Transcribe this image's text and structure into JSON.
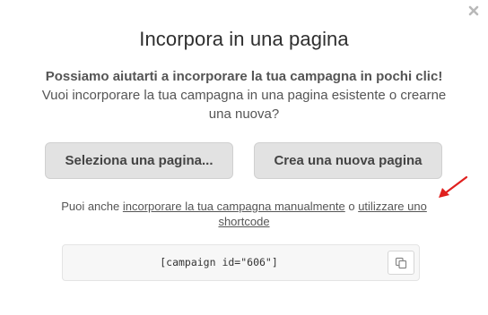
{
  "modal": {
    "close_icon": "close-icon",
    "title": "Incorpora in una pagina",
    "intro_bold": "Possiamo aiutarti a incorporare la tua campagna in pochi clic!",
    "intro_text": "Vuoi incorporare la tua campagna in una pagina esistente o crearne una nuova?"
  },
  "buttons": {
    "select_page": "Seleziona una pagina...",
    "create_page": "Crea una nuova pagina"
  },
  "alternative": {
    "prefix": "Puoi anche ",
    "manual_link": "incorporare la tua campagna manualmente",
    "middle": " o ",
    "shortcode_link": "utilizzare uno shortcode"
  },
  "shortcode": {
    "code": "[campaign id=\"606\"]",
    "copy_icon": "copy-icon"
  },
  "colors": {
    "arrow": "#e0201e",
    "button_bg": "#e2e2e2",
    "code_bg": "#f7f7f7"
  }
}
